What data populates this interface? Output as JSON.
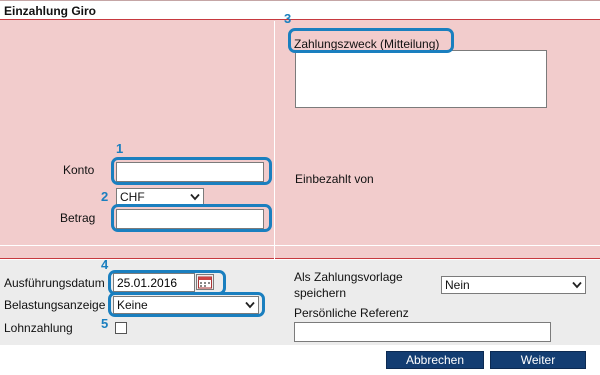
{
  "title": "Einzahlung Giro",
  "labels": {
    "konto": "Konto",
    "betrag": "Betrag",
    "zahlungszweck": "Zahlungszweck (Mitteilung)",
    "einbezahlt_von": "Einbezahlt von",
    "ausfuehrungsdatum": "Ausführungsdatum",
    "belastungsanzeige": "Belastungsanzeige",
    "lohnzahlung": "Lohnzahlung",
    "als_vorlage": "Als Zahlungsvorlage\nspeichern",
    "persoenliche_referenz": "Persönliche Referenz"
  },
  "fields": {
    "konto_value": "",
    "betrag_value": "",
    "zahlungszweck_value": "",
    "currency": "CHF",
    "datum": "25.01.2016",
    "belastungsanzeige": "Keine",
    "als_vorlage": "Nein",
    "referenz_value": ""
  },
  "markers": [
    "1",
    "2",
    "3",
    "4",
    "5"
  ],
  "buttons": {
    "abbrechen": "Abbrechen",
    "weiter": "Weiter"
  },
  "colors": {
    "panel_bg": "#f2cccc",
    "accent_red": "#c7393f",
    "highlight_blue": "#1a7fbf",
    "button_navy": "#133d72"
  }
}
